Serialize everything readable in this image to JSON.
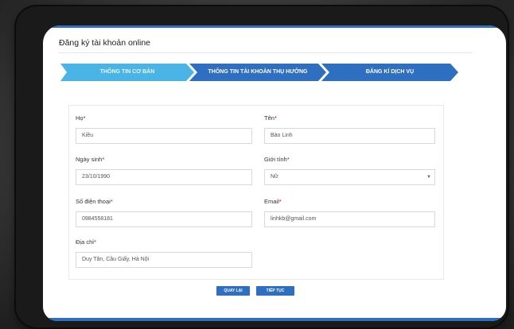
{
  "page": {
    "title": "Đăng ký tài khoản online"
  },
  "steps": [
    {
      "label": "THÔNG TIN CƠ BẢN",
      "state": "active"
    },
    {
      "label": "THÔNG TIN TÀI KHOẢN THỤ HƯỞNG",
      "state": "inactive"
    },
    {
      "label": "ĐĂNG KÍ DỊCH VỤ",
      "state": "inactive"
    }
  ],
  "form": {
    "ho": {
      "label": "Họ",
      "required_mark": "*",
      "value": "Kiều"
    },
    "ten": {
      "label": "Tên",
      "required_mark": "*",
      "value": "Bảo Linh"
    },
    "ngay_sinh": {
      "label": "Ngày sinh",
      "required_mark": "*",
      "value": "23/10/1990"
    },
    "gioi_tinh": {
      "label": "Giới tính",
      "required_mark": "*",
      "value": "Nữ"
    },
    "so_dien_thoai": {
      "label": "Số điện thoại",
      "required_mark": "*",
      "value": "0984558181"
    },
    "email": {
      "label": "Email",
      "required_mark": "*",
      "value": "linhkb@gmail.com"
    },
    "dia_chi": {
      "label": "Địa chỉ",
      "required_mark": "*",
      "value": "Duy Tân, Cầu Giấy, Hà Nội"
    }
  },
  "buttons": {
    "back_label": "QUAY LẠI",
    "next_label": "TIẾP TỤC"
  },
  "colors": {
    "accent": "#2f6fc1",
    "step_active": "#4bb4e6",
    "step_inactive": "#2f6fc1",
    "required": "#d0021b"
  },
  "icons": {
    "select_caret": "caret-down-icon"
  }
}
